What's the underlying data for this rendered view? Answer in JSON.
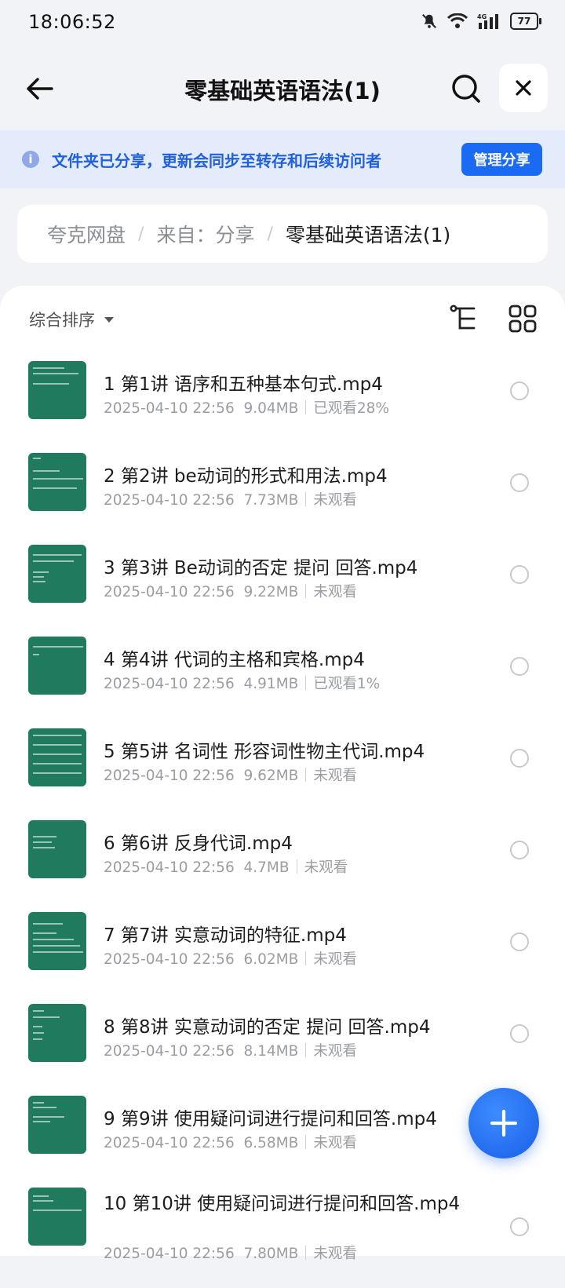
{
  "status": {
    "time": "18:06:52",
    "battery": "77",
    "network": "4G"
  },
  "header": {
    "title": "零基础英语语法(1)"
  },
  "banner": {
    "text": "文件夹已分享，更新会同步至转存和后续访问者",
    "button": "管理分享"
  },
  "breadcrumb": {
    "items": [
      "夸克网盘",
      "来自：分享",
      "零基础英语语法(1)"
    ]
  },
  "toolbar": {
    "sort_label": "综合排序"
  },
  "files": [
    {
      "name": "1 第1讲 语序和五种基本句式.mp4",
      "date": "2025-04-10 22:56",
      "size": "9.04MB",
      "status": "已观看28%"
    },
    {
      "name": "2 第2讲 be动词的形式和用法.mp4",
      "date": "2025-04-10 22:56",
      "size": "7.73MB",
      "status": "未观看"
    },
    {
      "name": "3 第3讲 Be动词的否定 提问 回答.mp4",
      "date": "2025-04-10 22:56",
      "size": "9.22MB",
      "status": "未观看"
    },
    {
      "name": "4 第4讲 代词的主格和宾格.mp4",
      "date": "2025-04-10 22:56",
      "size": "4.91MB",
      "status": "已观看1%"
    },
    {
      "name": "5 第5讲 名词性 形容词性物主代词.mp4",
      "date": "2025-04-10 22:56",
      "size": "9.62MB",
      "status": "未观看"
    },
    {
      "name": "6 第6讲 反身代词.mp4",
      "date": "2025-04-10 22:56",
      "size": "4.7MB",
      "status": "未观看"
    },
    {
      "name": "7 第7讲 实意动词的特征.mp4",
      "date": "2025-04-10 22:56",
      "size": "6.02MB",
      "status": "未观看"
    },
    {
      "name": "8 第8讲 实意动词的否定 提问 回答.mp4",
      "date": "2025-04-10 22:56",
      "size": "8.14MB",
      "status": "未观看"
    },
    {
      "name": "9 第9讲 使用疑问词进行提问和回答.mp4",
      "date": "2025-04-10 22:56",
      "size": "6.58MB",
      "status": "未观看"
    },
    {
      "name": "10 第10讲 使用疑问词进行提问和回答.mp4",
      "date": "2025-04-10 22:56",
      "size": "7.80MB",
      "status": "未观看"
    }
  ],
  "colors": {
    "accent": "#1a6af4",
    "thumb": "#1f7a5e"
  }
}
